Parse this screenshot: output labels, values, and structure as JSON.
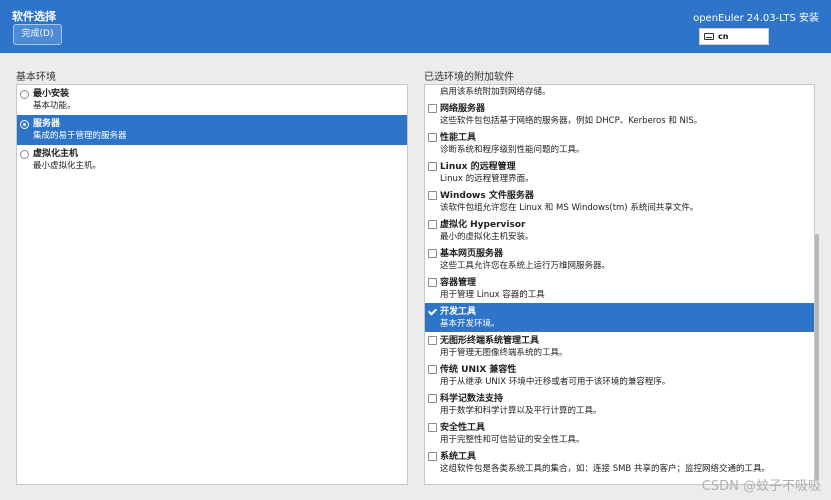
{
  "header": {
    "title": "软件选择",
    "done_label": "完成(D)",
    "product": "openEuler 24.03-LTS 安装",
    "keyboard_layout": "cn"
  },
  "base_env": {
    "title": "基本环境",
    "items": [
      {
        "name": "最小安装",
        "desc": "基本功能。",
        "selected": false
      },
      {
        "name": "服务器",
        "desc": "集成的易于管理的服务器",
        "selected": true
      },
      {
        "name": "虚拟化主机",
        "desc": "最小虚拟化主机。",
        "selected": false
      }
    ]
  },
  "addons": {
    "title": "已选环境的附加软件",
    "partial_desc": "启用该系统附加到网络存储。",
    "items": [
      {
        "name": "网络服务器",
        "desc": "这些软件包包括基于网络的服务器，例如 DHCP、Kerberos 和 NIS。",
        "checked": false
      },
      {
        "name": "性能工具",
        "desc": "诊断系统和程序级别性能问题的工具。",
        "checked": false
      },
      {
        "name": "Linux 的远程管理",
        "desc": "Linux 的远程管理界面。",
        "checked": false
      },
      {
        "name": "Windows 文件服务器",
        "desc": "该软件包组允许您在 Linux 和 MS Windows(tm) 系统间共享文件。",
        "checked": false
      },
      {
        "name": "虚拟化 Hypervisor",
        "desc": "最小的虚拟化主机安装。",
        "checked": false
      },
      {
        "name": "基本网页服务器",
        "desc": "这些工具允许您在系统上运行万维网服务器。",
        "checked": false
      },
      {
        "name": "容器管理",
        "desc": "用于管理 Linux 容器的工具",
        "checked": false
      },
      {
        "name": "开发工具",
        "desc": "基本开发环境。",
        "checked": true
      },
      {
        "name": "无图形终端系统管理工具",
        "desc": "用于管理无图像终端系统的工具。",
        "checked": false
      },
      {
        "name": "传统 UNIX 兼容性",
        "desc": "用于从继承 UNIX 环境中迁移或者可用于该环境的兼容程序。",
        "checked": false
      },
      {
        "name": "科学记数法支持",
        "desc": "用于数学和科学计算以及平行计算的工具。",
        "checked": false
      },
      {
        "name": "安全性工具",
        "desc": "用于完整性和可信验证的安全性工具。",
        "checked": false
      },
      {
        "name": "系统工具",
        "desc": "这组软件包是各类系统工具的集合，如：连接 SMB 共享的客户；监控网络交通的工具。",
        "checked": false
      }
    ]
  },
  "watermark": "CSDN @蚊子不吸吸",
  "colors": {
    "accent": "#2e74c9",
    "background": "#ececec"
  }
}
